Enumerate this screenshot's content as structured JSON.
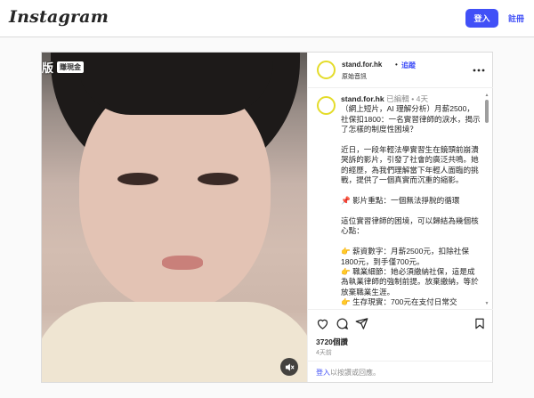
{
  "header": {
    "logo": "Instagram",
    "login_label": "登入",
    "signup_label": "註冊"
  },
  "media": {
    "overlay_char": "版",
    "overlay_badge": "賺現金",
    "mute_icon": "speaker-muted-icon"
  },
  "post": {
    "username": "stand.for.hk",
    "separator": "•",
    "follow_label": "追蹤",
    "audio": "原始音訊",
    "more_icon": "more-options-icon",
    "caption": {
      "user": "stand.for.hk",
      "meta": " 已編輯 • 4天",
      "body": "（網上短片，AI 理解分析）月薪2500，社保扣1800：一名實習律師的淚水，揭示了怎樣的制度性困境？\n\n近日，一段年輕法學實習生在鏡頭前崩潰哭訴的影片，引發了社會的廣泛共鳴。她的經歷，為我們理解當下年輕人面臨的挑戰，提供了一個真實而沉重的縮影。\n\n📌 影片重點：一個無法掙脫的循環\n\n這位實習律師的困境，可以歸結為幾個核心點：\n\n👉 薪資數字：月薪2500元，扣除社保1800元，到手僅700元。\n👉 職業細節：她必須繳納社保，這是成為執業律師的強制前提。放棄繳納，等於放棄職業生涯。\n👉 生存現實：700元在支付日常交"
    },
    "likes": "3720個讚",
    "time": "4天前",
    "login_prompt_link": "登入",
    "login_prompt_text": "以按讚或回應。"
  },
  "colors": {
    "accent": "#4150f7",
    "avatar_ring": "#e4dc2a"
  }
}
